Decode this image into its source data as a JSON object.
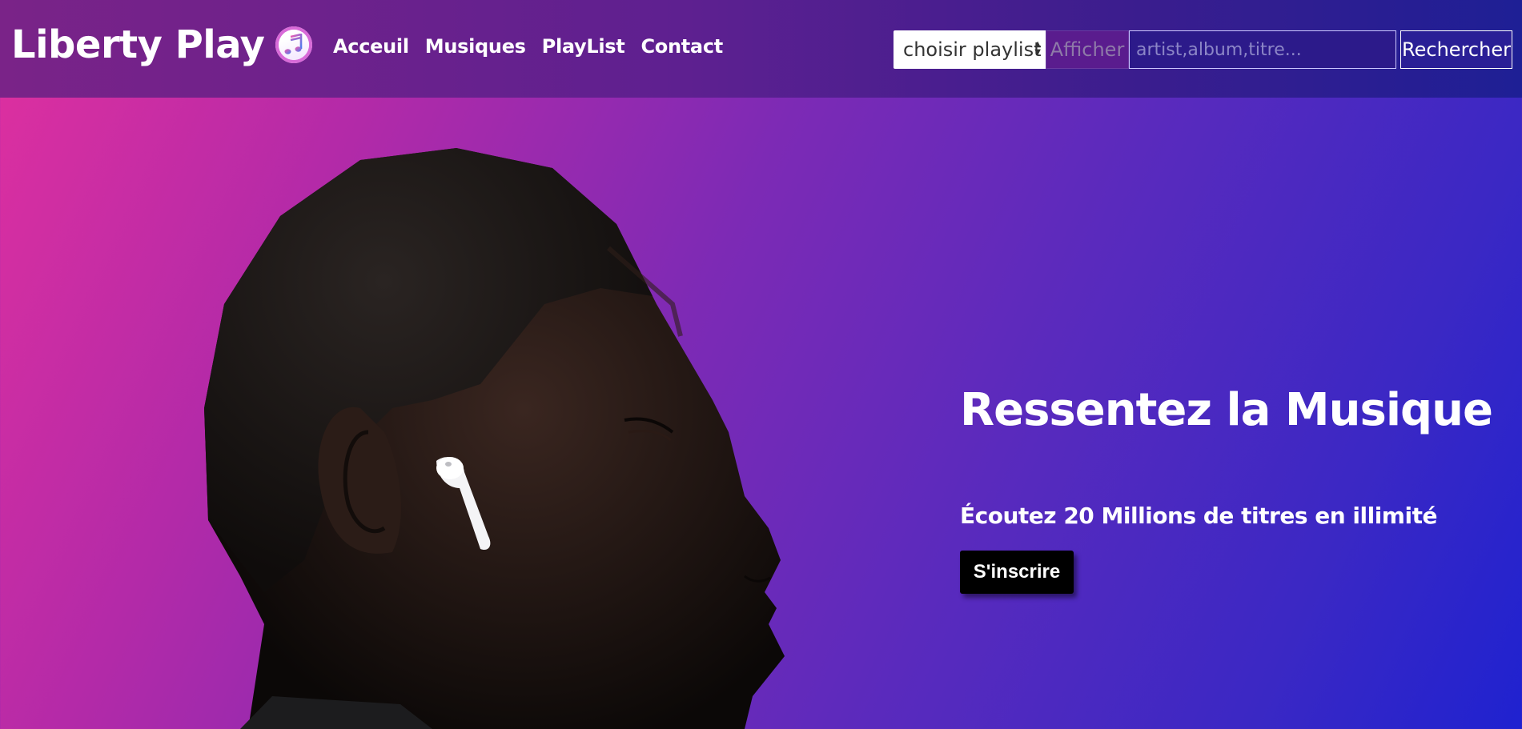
{
  "brand": {
    "name": "Liberty Play",
    "logo_icon": "itunes-music-icon"
  },
  "nav": {
    "items": [
      {
        "label": "Acceuil"
      },
      {
        "label": "Musiques"
      },
      {
        "label": "PlayList"
      },
      {
        "label": "Contact"
      }
    ]
  },
  "search": {
    "playlist_select": {
      "selected": "choisir playlist"
    },
    "afficher_label": "Afficher",
    "placeholder": "artist,album,titre...",
    "value": "",
    "button_label": "Rechercher"
  },
  "hero": {
    "title": "Ressentez la Musique",
    "subtitle": "Écoutez 20 Millions de titres en illimité",
    "cta_label": "S'inscrire",
    "image": "man-with-wireless-earbud-profile"
  },
  "colors": {
    "gradient_start": "#e0309f",
    "gradient_end": "#1f22d0",
    "navbar": "#5e2090",
    "cta_bg": "#000000"
  }
}
